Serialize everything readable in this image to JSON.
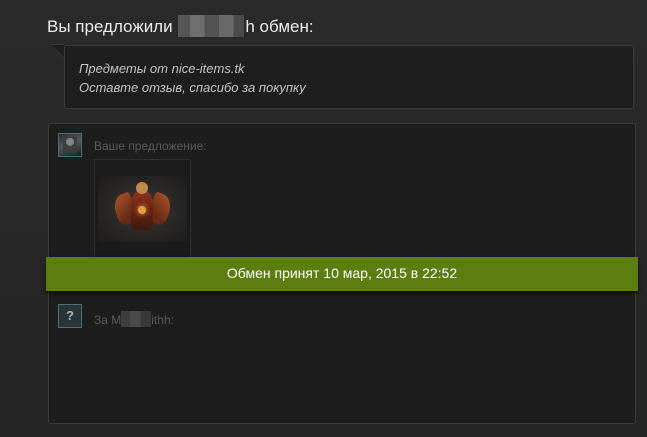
{
  "header": {
    "prefix": "Вы предложили",
    "name_tail": "h",
    "suffix": "обмен:"
  },
  "message": {
    "line1": "Предметы от nice-items.tk",
    "line2": "Оставте отзыв, спасибо за покупку"
  },
  "your_offer": {
    "label": "Ваше предложение:",
    "avatar_icon": "user-avatar",
    "item_icon": "hero-item-image"
  },
  "status": {
    "text": "Обмен принят 10 мар, 2015 в 22:52",
    "color": "#5c7e10"
  },
  "partner_offer": {
    "label_prefix": "За M",
    "label_suffix": "ithh:",
    "avatar_glyph": "?"
  }
}
